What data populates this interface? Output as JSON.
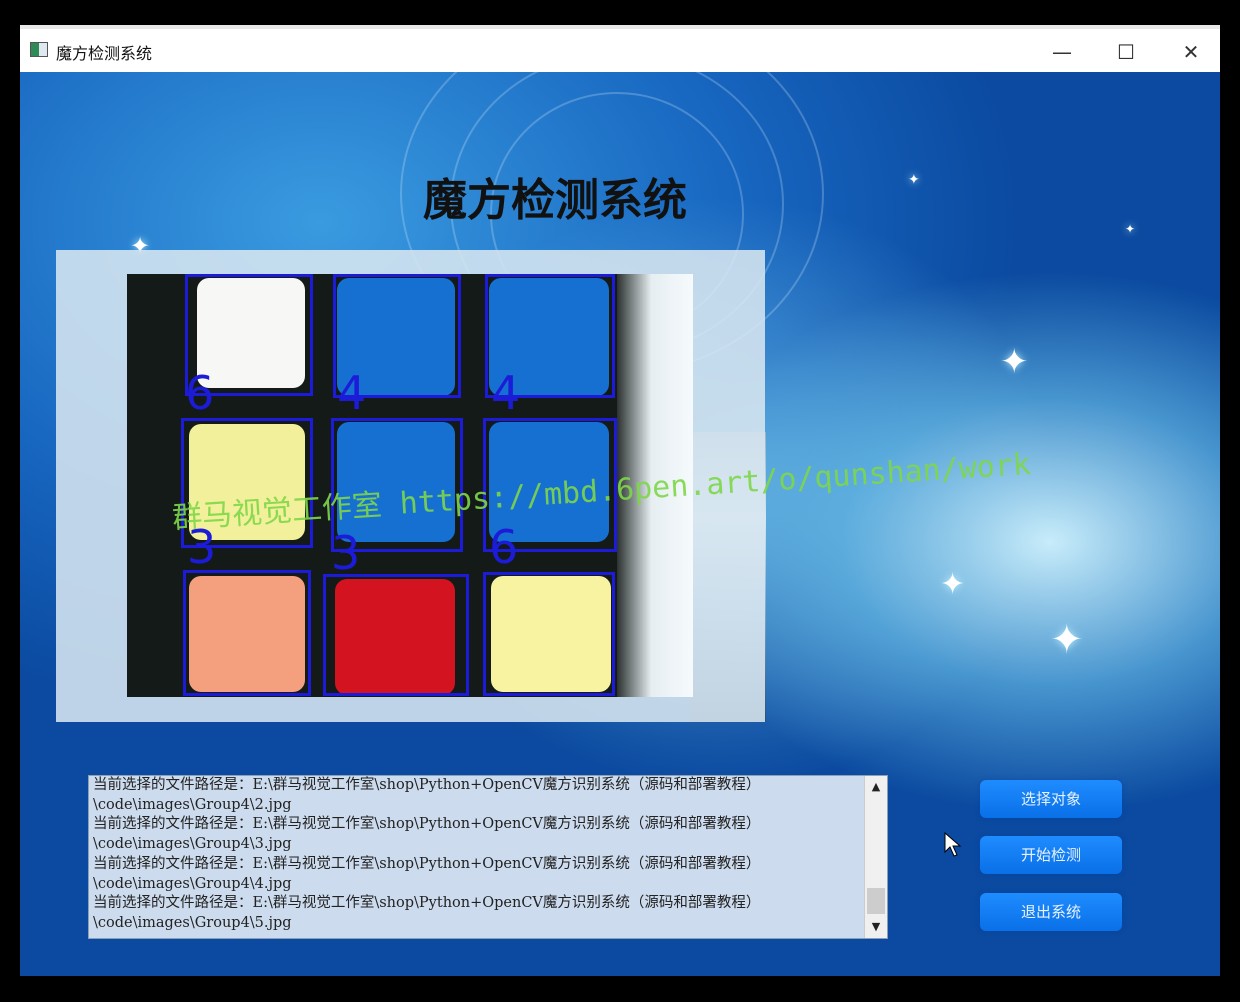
{
  "window": {
    "title": "魔方检测系统",
    "controls": {
      "minimize": "—",
      "maximize": "☐",
      "close": "✕"
    }
  },
  "main_title": "魔方检测系统",
  "display": {
    "tile_colors": [
      "#f7f8f6",
      "#1670d2",
      "#1670d2",
      "#f2f09a",
      "#1670d2",
      "#1670d2",
      "#f4a07e",
      "#d3131f",
      "#f7f3a0"
    ],
    "labels": [
      "6",
      "4",
      "4",
      "3",
      "3",
      "6"
    ],
    "watermark": "群马视觉工作室 https://mbd.6pen.art/o/qunshan/work"
  },
  "log": {
    "lines": [
      "当前选择的文件路径是：E:\\群马视觉工作室\\shop\\Python+OpenCV魔方识别系统（源码和部署教程）",
      "\\code\\images\\Group4\\2.jpg",
      "当前选择的文件路径是：E:\\群马视觉工作室\\shop\\Python+OpenCV魔方识别系统（源码和部署教程）",
      "\\code\\images\\Group4\\3.jpg",
      "当前选择的文件路径是：E:\\群马视觉工作室\\shop\\Python+OpenCV魔方识别系统（源码和部署教程）",
      "\\code\\images\\Group4\\4.jpg",
      "当前选择的文件路径是：E:\\群马视觉工作室\\shop\\Python+OpenCV魔方识别系统（源码和部署教程）",
      "\\code\\images\\Group4\\5.jpg"
    ]
  },
  "buttons": {
    "select": "选择对象",
    "detect": "开始检测",
    "exit": "退出系统"
  }
}
